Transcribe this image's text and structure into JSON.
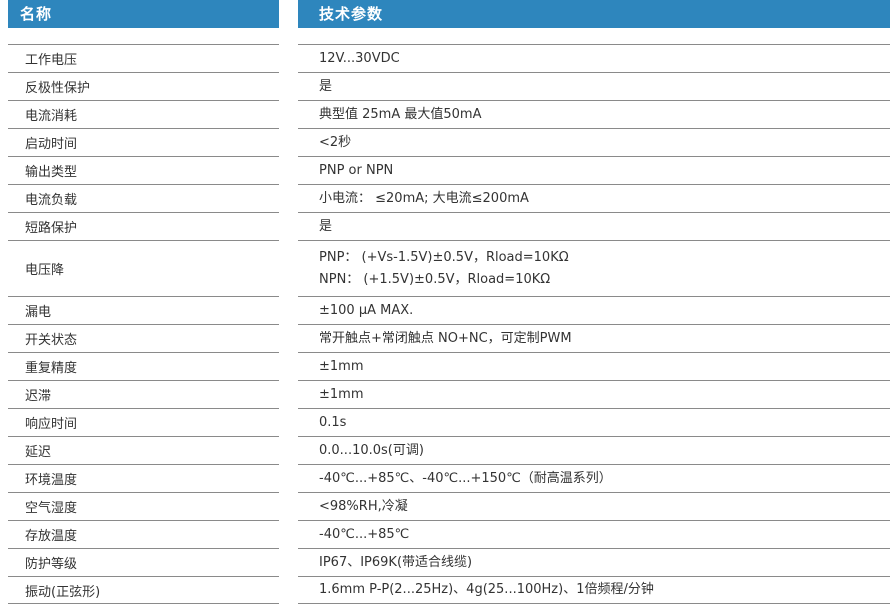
{
  "header": {
    "name_label": "名称",
    "spec_label": "技术参数"
  },
  "rows": [
    {
      "name": "工作电压",
      "value": [
        "12V...30VDC"
      ]
    },
    {
      "name": "反极性保护",
      "value": [
        "是"
      ]
    },
    {
      "name": "电流消耗",
      "value": [
        "典型值 25mA  最大值50mA"
      ]
    },
    {
      "name": "启动时间",
      "value": [
        "<2秒"
      ]
    },
    {
      "name": "输出类型",
      "value": [
        "PNP or NPN"
      ]
    },
    {
      "name": "电流负载",
      "value": [
        "小电流： ≤20mA; 大电流≤200mA"
      ]
    },
    {
      "name": "短路保护",
      "value": [
        "是"
      ]
    },
    {
      "name": "电压降",
      "value": [
        "PNP：  (+Vs-1.5V)±0.5V，Rload=10KΩ",
        "NPN：  (+1.5V)±0.5V，Rload=10KΩ"
      ]
    },
    {
      "name": "漏电",
      "value": [
        "±100 μA MAX."
      ]
    },
    {
      "name": "开关状态",
      "value": [
        "常开触点+常闭触点 NO+NC，可定制PWM"
      ]
    },
    {
      "name": "重复精度",
      "value": [
        "±1mm"
      ]
    },
    {
      "name": "迟滞",
      "value": [
        "±1mm"
      ]
    },
    {
      "name": "响应时间",
      "value": [
        "0.1s"
      ]
    },
    {
      "name": "延迟",
      "value": [
        "0.0...10.0s(可调)"
      ]
    },
    {
      "name": "环境温度",
      "value": [
        "-40℃...+85℃、-40℃...+150℃（耐高温系列）"
      ]
    },
    {
      "name": "空气湿度",
      "value": [
        "<98%RH,冷凝"
      ]
    },
    {
      "name": "存放温度",
      "value": [
        "-40℃...+85℃"
      ]
    },
    {
      "name": "防护等级",
      "value": [
        "IP67、IP69K(带适合线缆)"
      ]
    },
    {
      "name": "振动(正弦形)",
      "value": [
        "1.6mm P-P(2...25Hz)、4g(25...100Hz)、1倍频程/分钟"
      ]
    }
  ],
  "colors": {
    "header_bg": "#2e86bd",
    "header_text": "#ffffff",
    "rule": "#8a8a8a",
    "text": "#333333"
  }
}
